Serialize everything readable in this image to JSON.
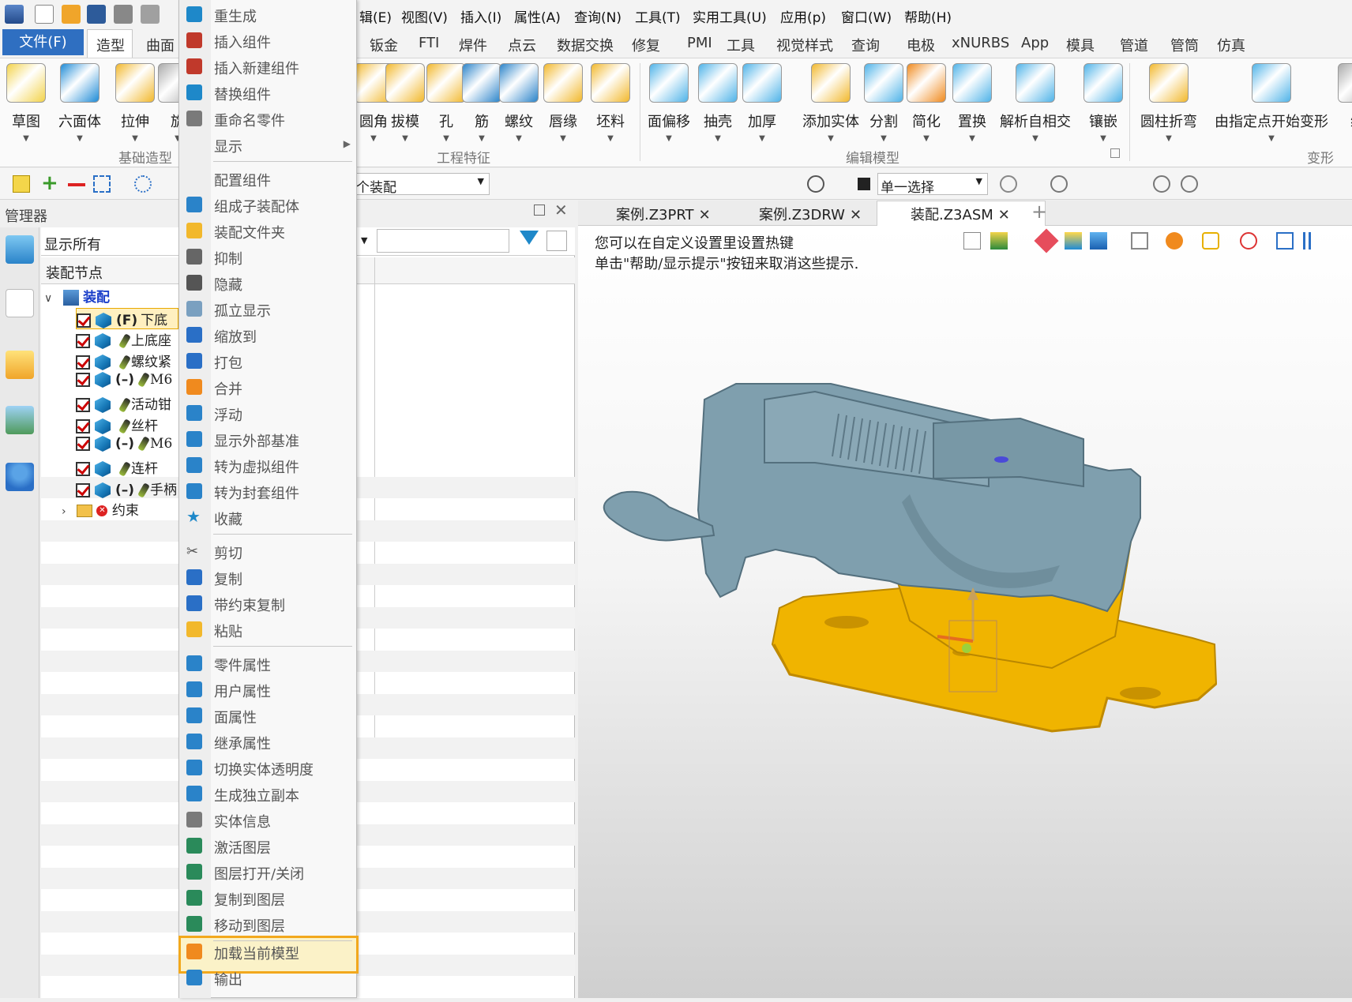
{
  "menu_bar": [
    "辑(E)",
    "视图(V)",
    "插入(I)",
    "属性(A)",
    "查询(N)",
    "工具(T)",
    "实用工具(U)",
    "应用(p)",
    "窗口(W)",
    "帮助(H)"
  ],
  "ribbon_tabs": {
    "file": "文件(F)",
    "active": "造型",
    "left": [
      "曲面"
    ],
    "right": [
      "钣金",
      "FTI",
      "焊件",
      "点云",
      "数据交换",
      "修复",
      "PMI",
      "工具",
      "视觉样式",
      "查询",
      "电极",
      "xNURBS",
      "App",
      "模具",
      "管道",
      "管筒",
      "仿真"
    ]
  },
  "ribbon": {
    "basic": [
      {
        "label": "草图"
      },
      {
        "label": "六面体"
      },
      {
        "label": "拉伸"
      },
      {
        "label": "旋"
      }
    ],
    "eng": [
      {
        "label": "圆角"
      },
      {
        "label": "拔模"
      },
      {
        "label": "孔"
      },
      {
        "label": "筋"
      },
      {
        "label": "螺纹"
      },
      {
        "label": "唇缘"
      },
      {
        "label": "坯料"
      }
    ],
    "edit": [
      {
        "label": "面偏移"
      },
      {
        "label": "抽壳"
      },
      {
        "label": "加厚"
      },
      {
        "label": "添加实体"
      },
      {
        "label": "分割"
      },
      {
        "label": "简化"
      },
      {
        "label": "置换"
      },
      {
        "label": "解析自相交"
      },
      {
        "label": "镶嵌"
      }
    ],
    "deform": [
      {
        "label": "圆柱折弯"
      },
      {
        "label": "由指定点开始变形"
      },
      {
        "label": "缠"
      }
    ],
    "groups": {
      "basic": "基础造型",
      "eng": "工程特征",
      "edit": "编辑模型",
      "deform": "变形"
    }
  },
  "toolbar2": {
    "filter_value": "个装配",
    "select_mode": "单一选择"
  },
  "manager": {
    "title": "管理器",
    "show_all": "显示所有",
    "column_header": "装配节点",
    "root": "装配",
    "rows": [
      {
        "prefix": "(F)",
        "name": "下底"
      },
      {
        "prefix": "",
        "name": "上底座"
      },
      {
        "prefix": "",
        "name": "螺纹紧"
      },
      {
        "prefix": "(–)",
        "name": "M6"
      },
      {
        "prefix": "",
        "name": "活动钳"
      },
      {
        "prefix": "",
        "name": "丝杆"
      },
      {
        "prefix": "(–)",
        "name": "M6"
      },
      {
        "prefix": "",
        "name": "连杆"
      },
      {
        "prefix": "(–)",
        "name": "手柄"
      }
    ],
    "constraints": "约束"
  },
  "context_menu": [
    {
      "label": "重生成",
      "icon": "regenerate-icon"
    },
    {
      "label": "插入组件",
      "icon": "insert-component-icon"
    },
    {
      "label": "插入新建组件",
      "icon": "insert-new-component-icon"
    },
    {
      "label": "替换组件",
      "icon": "replace-component-icon"
    },
    {
      "label": "重命名零件",
      "icon": "rename-icon"
    },
    {
      "label": "显示",
      "icon": "",
      "submenu": true
    },
    {
      "label": "配置组件",
      "icon": "",
      "sep_before": true
    },
    {
      "label": "组成子装配体",
      "icon": "subassembly-icon"
    },
    {
      "label": "装配文件夹",
      "icon": "folder-icon"
    },
    {
      "label": "抑制",
      "icon": "suppress-icon"
    },
    {
      "label": "隐藏",
      "icon": "hide-icon"
    },
    {
      "label": "孤立显示",
      "icon": "isolate-icon"
    },
    {
      "label": "缩放到",
      "icon": "zoom-to-icon"
    },
    {
      "label": "打包",
      "icon": "pack-icon"
    },
    {
      "label": "合并",
      "icon": "merge-icon"
    },
    {
      "label": "浮动",
      "icon": "float-icon"
    },
    {
      "label": "显示外部基准",
      "icon": "datum-icon"
    },
    {
      "label": "转为虚拟组件",
      "icon": "virtual-icon"
    },
    {
      "label": "转为封套组件",
      "icon": "envelope-icon"
    },
    {
      "label": "收藏",
      "icon": "star-icon"
    },
    {
      "label": "剪切",
      "icon": "scissors-icon",
      "sep_before": true
    },
    {
      "label": "复制",
      "icon": "copy-icon"
    },
    {
      "label": "带约束复制",
      "icon": "copy-constraint-icon"
    },
    {
      "label": "粘贴",
      "icon": "paste-icon"
    },
    {
      "label": "零件属性",
      "icon": "part-props-icon",
      "sep_before": true
    },
    {
      "label": "用户属性",
      "icon": "user-props-icon"
    },
    {
      "label": "面属性",
      "icon": "face-props-icon"
    },
    {
      "label": "继承属性",
      "icon": "inherit-icon"
    },
    {
      "label": "切换实体透明度",
      "icon": "transparency-icon"
    },
    {
      "label": "生成独立副本",
      "icon": "copy-independent-icon"
    },
    {
      "label": "实体信息",
      "icon": "info-icon"
    },
    {
      "label": "激活图层",
      "icon": "layer-icon"
    },
    {
      "label": "图层打开/关闭",
      "icon": "layer-toggle-icon"
    },
    {
      "label": "复制到图层",
      "icon": "layer-copy-icon"
    },
    {
      "label": "移动到图层",
      "icon": "layer-move-icon"
    },
    {
      "label": "加载当前模型",
      "icon": "load-model-icon",
      "sep_before": true,
      "highlight": true
    },
    {
      "label": "输出",
      "icon": "export-icon"
    }
  ],
  "doc_tabs": [
    {
      "label": "案例.Z3PRT"
    },
    {
      "label": "案例.Z3DRW"
    },
    {
      "label": "装配.Z3ASM",
      "active": true
    }
  ],
  "hints": [
    "您可以在自定义设置里设置热键",
    "单击\"帮助/显示提示\"按钮来取消这些提示."
  ],
  "colors": {
    "accent": "#2f6fc1",
    "highlight": "#f2a81d",
    "model_body": "#7f9fae",
    "model_base": "#f0b400"
  }
}
